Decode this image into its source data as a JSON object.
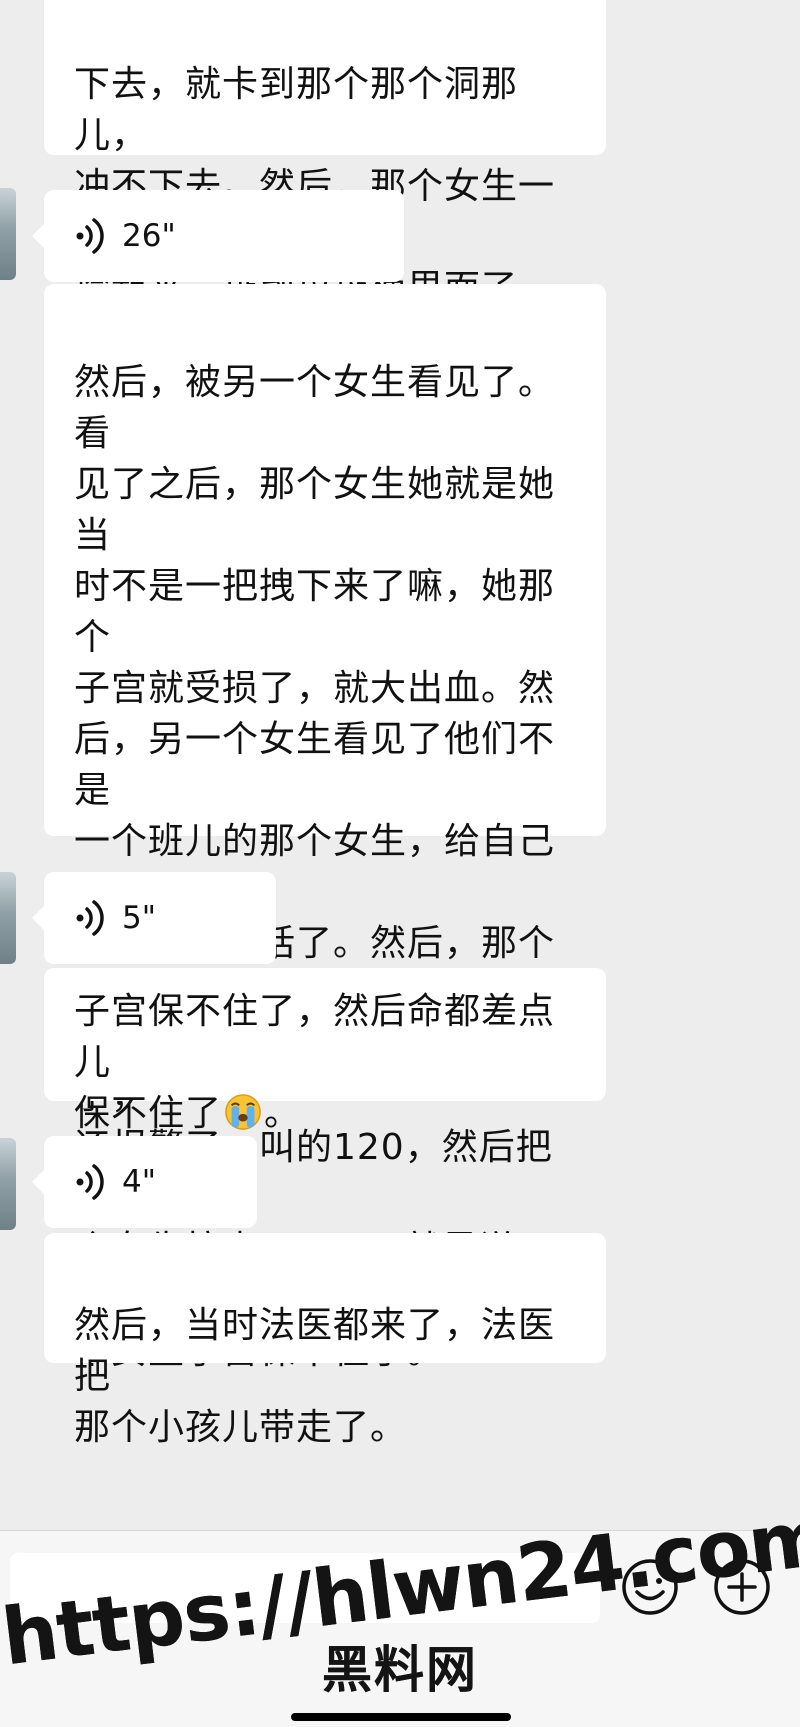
{
  "messages": [
    {
      "type": "text",
      "text": "下去，就卡到那个那个洞那儿，\n冲不下去。然后，那个女生一把\n捡起来，扔到垃圾桶里面了。"
    },
    {
      "type": "voice",
      "duration": "26\""
    },
    {
      "type": "text",
      "text": "然后，被另一个女生看见了。看\n见了之后，那个女生她就是她当\n时不是一把拽下来了嘛，她那个\n子宫就受损了，就大出血。然\n后，另一个女生看见了他们不是\n一个班儿的那个女生，给自己的\n班主任打电话了。然后，那个那\n个班主任就来了。班主任来了，\n还报警了，叫的120，然后把那\n个女生拉走了。120就是说，那\n个女生子宫保不住了。"
    },
    {
      "type": "voice",
      "duration": "5\""
    },
    {
      "type": "text",
      "text_line1": "子宫保不住了，然后命都差点儿",
      "text_line2_before": "保不住了",
      "emoji": "crying-face",
      "text_line2_after": "。"
    },
    {
      "type": "voice",
      "duration": "4\""
    },
    {
      "type": "text",
      "text": "然后，当时法医都来了，法医把\n那个小孩儿带走了。"
    }
  ],
  "input_bar": {
    "placeholder": "",
    "emoji_icon": "smiley-icon",
    "plus_icon": "plus-circle-icon"
  },
  "watermark": {
    "url": "https://hlwn24.com",
    "name": "黑料网"
  },
  "colors": {
    "background": "#ededed",
    "bubble": "#ffffff",
    "text": "#111111"
  }
}
